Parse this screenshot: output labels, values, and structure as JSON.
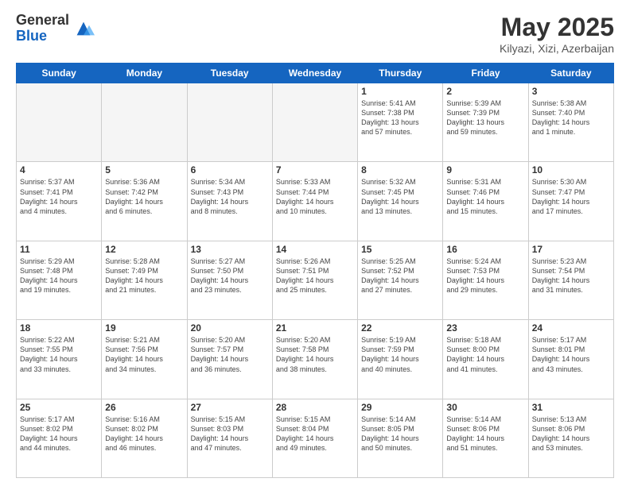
{
  "logo": {
    "general": "General",
    "blue": "Blue"
  },
  "header": {
    "month": "May 2025",
    "location": "Kilyazi, Xizi, Azerbaijan"
  },
  "weekdays": [
    "Sunday",
    "Monday",
    "Tuesday",
    "Wednesday",
    "Thursday",
    "Friday",
    "Saturday"
  ],
  "weeks": [
    [
      {
        "day": "",
        "info": ""
      },
      {
        "day": "",
        "info": ""
      },
      {
        "day": "",
        "info": ""
      },
      {
        "day": "",
        "info": ""
      },
      {
        "day": "1",
        "info": "Sunrise: 5:41 AM\nSunset: 7:38 PM\nDaylight: 13 hours\nand 57 minutes."
      },
      {
        "day": "2",
        "info": "Sunrise: 5:39 AM\nSunset: 7:39 PM\nDaylight: 13 hours\nand 59 minutes."
      },
      {
        "day": "3",
        "info": "Sunrise: 5:38 AM\nSunset: 7:40 PM\nDaylight: 14 hours\nand 1 minute."
      }
    ],
    [
      {
        "day": "4",
        "info": "Sunrise: 5:37 AM\nSunset: 7:41 PM\nDaylight: 14 hours\nand 4 minutes."
      },
      {
        "day": "5",
        "info": "Sunrise: 5:36 AM\nSunset: 7:42 PM\nDaylight: 14 hours\nand 6 minutes."
      },
      {
        "day": "6",
        "info": "Sunrise: 5:34 AM\nSunset: 7:43 PM\nDaylight: 14 hours\nand 8 minutes."
      },
      {
        "day": "7",
        "info": "Sunrise: 5:33 AM\nSunset: 7:44 PM\nDaylight: 14 hours\nand 10 minutes."
      },
      {
        "day": "8",
        "info": "Sunrise: 5:32 AM\nSunset: 7:45 PM\nDaylight: 14 hours\nand 13 minutes."
      },
      {
        "day": "9",
        "info": "Sunrise: 5:31 AM\nSunset: 7:46 PM\nDaylight: 14 hours\nand 15 minutes."
      },
      {
        "day": "10",
        "info": "Sunrise: 5:30 AM\nSunset: 7:47 PM\nDaylight: 14 hours\nand 17 minutes."
      }
    ],
    [
      {
        "day": "11",
        "info": "Sunrise: 5:29 AM\nSunset: 7:48 PM\nDaylight: 14 hours\nand 19 minutes."
      },
      {
        "day": "12",
        "info": "Sunrise: 5:28 AM\nSunset: 7:49 PM\nDaylight: 14 hours\nand 21 minutes."
      },
      {
        "day": "13",
        "info": "Sunrise: 5:27 AM\nSunset: 7:50 PM\nDaylight: 14 hours\nand 23 minutes."
      },
      {
        "day": "14",
        "info": "Sunrise: 5:26 AM\nSunset: 7:51 PM\nDaylight: 14 hours\nand 25 minutes."
      },
      {
        "day": "15",
        "info": "Sunrise: 5:25 AM\nSunset: 7:52 PM\nDaylight: 14 hours\nand 27 minutes."
      },
      {
        "day": "16",
        "info": "Sunrise: 5:24 AM\nSunset: 7:53 PM\nDaylight: 14 hours\nand 29 minutes."
      },
      {
        "day": "17",
        "info": "Sunrise: 5:23 AM\nSunset: 7:54 PM\nDaylight: 14 hours\nand 31 minutes."
      }
    ],
    [
      {
        "day": "18",
        "info": "Sunrise: 5:22 AM\nSunset: 7:55 PM\nDaylight: 14 hours\nand 33 minutes."
      },
      {
        "day": "19",
        "info": "Sunrise: 5:21 AM\nSunset: 7:56 PM\nDaylight: 14 hours\nand 34 minutes."
      },
      {
        "day": "20",
        "info": "Sunrise: 5:20 AM\nSunset: 7:57 PM\nDaylight: 14 hours\nand 36 minutes."
      },
      {
        "day": "21",
        "info": "Sunrise: 5:20 AM\nSunset: 7:58 PM\nDaylight: 14 hours\nand 38 minutes."
      },
      {
        "day": "22",
        "info": "Sunrise: 5:19 AM\nSunset: 7:59 PM\nDaylight: 14 hours\nand 40 minutes."
      },
      {
        "day": "23",
        "info": "Sunrise: 5:18 AM\nSunset: 8:00 PM\nDaylight: 14 hours\nand 41 minutes."
      },
      {
        "day": "24",
        "info": "Sunrise: 5:17 AM\nSunset: 8:01 PM\nDaylight: 14 hours\nand 43 minutes."
      }
    ],
    [
      {
        "day": "25",
        "info": "Sunrise: 5:17 AM\nSunset: 8:02 PM\nDaylight: 14 hours\nand 44 minutes."
      },
      {
        "day": "26",
        "info": "Sunrise: 5:16 AM\nSunset: 8:02 PM\nDaylight: 14 hours\nand 46 minutes."
      },
      {
        "day": "27",
        "info": "Sunrise: 5:15 AM\nSunset: 8:03 PM\nDaylight: 14 hours\nand 47 minutes."
      },
      {
        "day": "28",
        "info": "Sunrise: 5:15 AM\nSunset: 8:04 PM\nDaylight: 14 hours\nand 49 minutes."
      },
      {
        "day": "29",
        "info": "Sunrise: 5:14 AM\nSunset: 8:05 PM\nDaylight: 14 hours\nand 50 minutes."
      },
      {
        "day": "30",
        "info": "Sunrise: 5:14 AM\nSunset: 8:06 PM\nDaylight: 14 hours\nand 51 minutes."
      },
      {
        "day": "31",
        "info": "Sunrise: 5:13 AM\nSunset: 8:06 PM\nDaylight: 14 hours\nand 53 minutes."
      }
    ]
  ]
}
